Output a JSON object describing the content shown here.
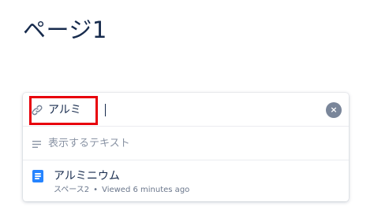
{
  "page": {
    "title": "ページ1"
  },
  "link_dialog": {
    "url_input": {
      "value": "アルミ",
      "icon": "link-icon"
    },
    "clear_button": {
      "symbol": "×",
      "icon": "clear-icon"
    },
    "text_input": {
      "placeholder": "表示するテキスト",
      "value": "",
      "icon": "text-lines-icon"
    },
    "results": [
      {
        "title": "アルミニウム",
        "space": "スペース2",
        "separator": "•",
        "viewed": "Viewed 6 minutes ago",
        "icon": "page-icon"
      }
    ]
  },
  "colors": {
    "accent": "#2684ff",
    "highlight": "#e8000b",
    "text": "#172b4d",
    "muted": "#6b778c"
  }
}
